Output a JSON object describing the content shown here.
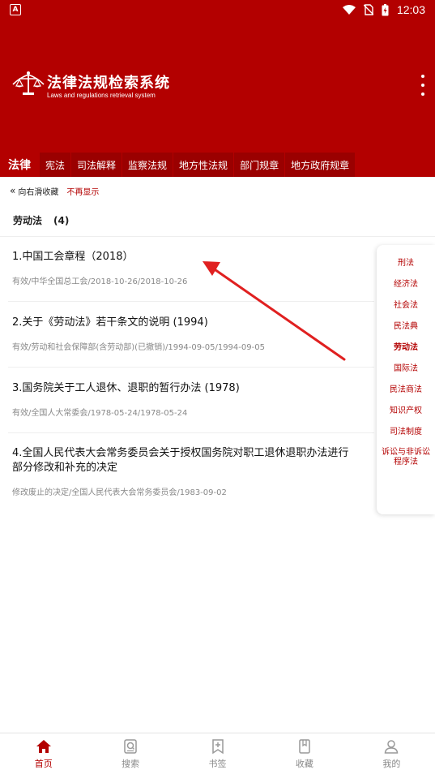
{
  "status_bar": {
    "time": "12:03",
    "badge": "A"
  },
  "header": {
    "title": "法律法规检索系统",
    "subtitle": "Laws and regulations retrieval system"
  },
  "tabs": [
    {
      "label": "法律"
    },
    {
      "label": "宪法"
    },
    {
      "label": "司法解释"
    },
    {
      "label": "监察法规"
    },
    {
      "label": "地方性法规"
    },
    {
      "label": "部门规章"
    },
    {
      "label": "地方政府规章"
    }
  ],
  "hint": {
    "text": "向右滑收藏",
    "dismiss": "不再显示"
  },
  "section": {
    "title": "劳动法",
    "count": "(4)"
  },
  "laws": [
    {
      "title": "1.中国工会章程（2018）",
      "meta": "有效/中华全国总工会/2018-10-26/2018-10-26"
    },
    {
      "title": "2.关于《劳动法》若干条文的说明 (1994)",
      "meta": "有效/劳动和社会保障部(含劳动部)(已撤销)/1994-09-05/1994-09-05"
    },
    {
      "title": "3.国务院关于工人退休、退职的暂行办法 (1978)",
      "meta": "有效/全国人大常委会/1978-05-24/1978-05-24"
    },
    {
      "title": "4.全国人民代表大会常务委员会关于授权国务院对职工退休退职办法进行部分修改和补充的决定",
      "meta": "修改废止的决定/全国人民代表大会常务委员会/1983-09-02"
    }
  ],
  "categories": [
    {
      "label": "刑法"
    },
    {
      "label": "经济法"
    },
    {
      "label": "社会法"
    },
    {
      "label": "民法典"
    },
    {
      "label": "劳动法"
    },
    {
      "label": "国际法"
    },
    {
      "label": "民法商法"
    },
    {
      "label": "知识产权"
    },
    {
      "label": "司法制度"
    },
    {
      "label": "诉讼与非诉讼程序法"
    }
  ],
  "bottom_nav": [
    {
      "label": "首页"
    },
    {
      "label": "搜索"
    },
    {
      "label": "书签"
    },
    {
      "label": "收藏"
    },
    {
      "label": "我的"
    }
  ],
  "colors": {
    "brand": "#b30000",
    "annotation_arrow": "#e02020"
  }
}
